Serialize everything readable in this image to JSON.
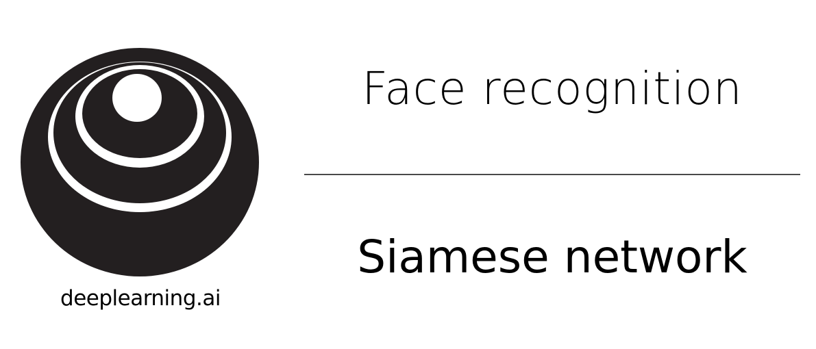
{
  "logo": {
    "icon": "deeplearning-ai-logo",
    "brand": "deeplearning.ai"
  },
  "slide": {
    "course": "Face recognition",
    "topic": "Siamese network"
  },
  "colors": {
    "foreground": "#000000",
    "logo_fill": "#231f20",
    "background": "#ffffff",
    "divider": "#4a4a4a"
  }
}
